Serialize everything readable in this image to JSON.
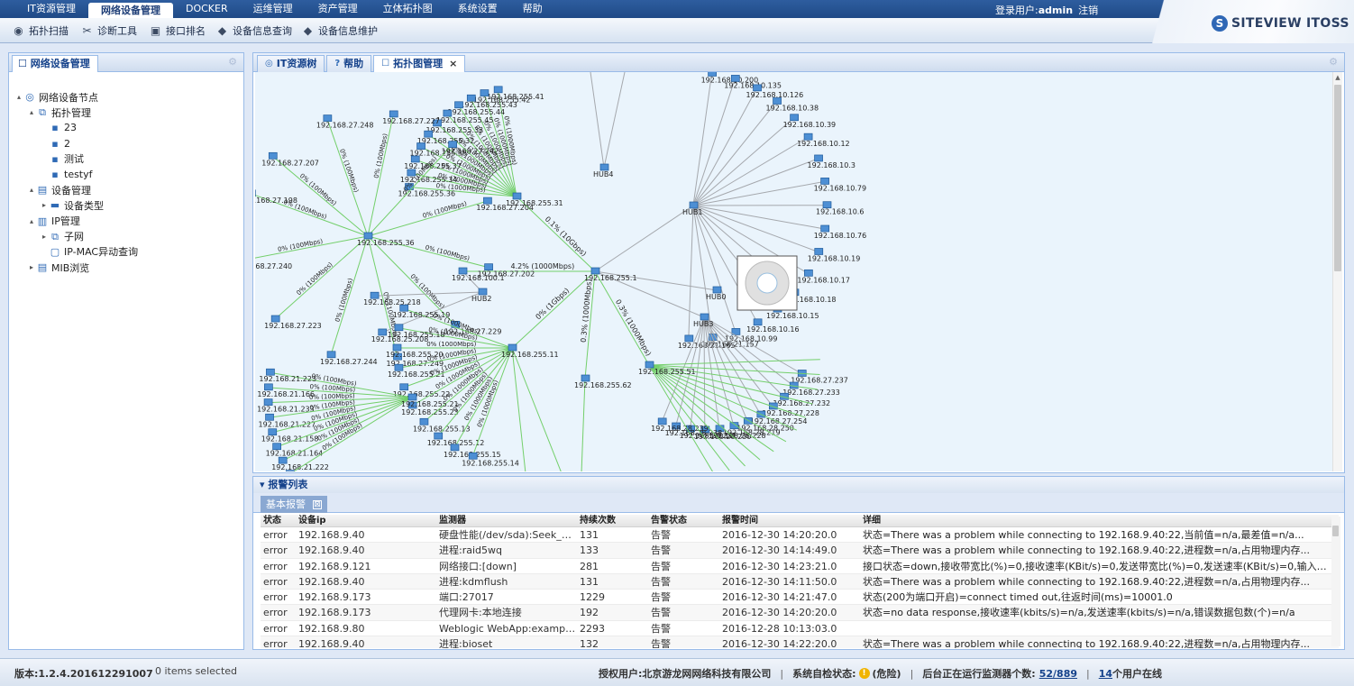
{
  "top_nav": {
    "items": [
      "IT资源管理",
      "网络设备管理",
      "DOCKER",
      "运维管理",
      "资产管理",
      "立体拓扑图",
      "系统设置",
      "帮助"
    ],
    "active_index": 1
  },
  "login": {
    "label": "登录用户:",
    "user": "admin",
    "logout": "注销"
  },
  "brand": {
    "mark": "S",
    "name": "SITEVIEW ITOSS",
    "accent": "#2f67b5"
  },
  "toolbar": [
    {
      "label": "拓扑扫描",
      "icon": "scan-icon"
    },
    {
      "label": "诊断工具",
      "icon": "tools-icon"
    },
    {
      "label": "接口排名",
      "icon": "monitor-icon"
    },
    {
      "label": "设备信息查询",
      "icon": "device-query-icon"
    },
    {
      "label": "设备信息维护",
      "icon": "device-maintain-icon"
    }
  ],
  "left_panel": {
    "title": "网络设备管理",
    "tree": [
      {
        "label": "网络设备节点",
        "level": 0,
        "arrow": "▴",
        "icon": "globe-icon"
      },
      {
        "label": "拓扑管理",
        "level": 1,
        "arrow": "▴",
        "icon": "topology-icon"
      },
      {
        "label": "23",
        "level": 2,
        "arrow": "",
        "icon": "topo-item-icon"
      },
      {
        "label": "2",
        "level": 2,
        "arrow": "",
        "icon": "topo-item-icon"
      },
      {
        "label": "测试",
        "level": 2,
        "arrow": "",
        "icon": "topo-item-icon"
      },
      {
        "label": "testyf",
        "level": 2,
        "arrow": "",
        "icon": "topo-item-icon"
      },
      {
        "label": "设备管理",
        "level": 1,
        "arrow": "▴",
        "icon": "device-icon"
      },
      {
        "label": "设备类型",
        "level": 2,
        "arrow": "▸",
        "icon": "device-type-icon"
      },
      {
        "label": "IP管理",
        "level": 1,
        "arrow": "▴",
        "icon": "ip-icon"
      },
      {
        "label": "子网",
        "level": 2,
        "arrow": "▸",
        "icon": "subnet-icon"
      },
      {
        "label": "IP-MAC异动查询",
        "level": 2,
        "arrow": "",
        "icon": "ipmac-icon"
      },
      {
        "label": "MIB浏览",
        "level": 1,
        "arrow": "▸",
        "icon": "mib-icon"
      }
    ]
  },
  "main_tabs": [
    {
      "label": "IT资源树",
      "icon": "resource-tree-icon",
      "active": false,
      "closable": false
    },
    {
      "label": "帮助",
      "icon": "help-icon",
      "active": false,
      "closable": false
    },
    {
      "label": "拓扑图管理",
      "icon": "topology-tab-icon",
      "active": true,
      "closable": true,
      "close": "×"
    }
  ],
  "topology": {
    "core": {
      "label": "192.168.255.1"
    },
    "core_links": [
      {
        "to": "192.168.255.31",
        "label": "0.1% (10Gbps)"
      },
      {
        "to": "192.168.100.1",
        "label": "4.2% (1000Mbps)"
      },
      {
        "to": "192.168.255.11",
        "label": "0% (1Gbps)"
      },
      {
        "to": "192.168.255.62",
        "label": "0.3% (1000Mbps)"
      },
      {
        "to": "192.168.255.51",
        "label": "0.3% (1000Mbps)"
      },
      {
        "to": "HUB0",
        "label": ""
      },
      {
        "to": "HUB1",
        "label": ""
      },
      {
        "to": "HUB3",
        "label": ""
      }
    ],
    "hubs": [
      "HUB4",
      "HUB1",
      "HUB0",
      "HUB2",
      "HUB3"
    ],
    "hub1_leaves": [
      "192.168.10.200",
      "192.168.10.135",
      "192.168.10.126",
      "192.168.10.38",
      "192.168.10.39",
      "192.168.10.12",
      "192.168.10.3",
      "192.168.10.79",
      "192.168.10.6",
      "192.168.10.76",
      "192.168.10.19",
      "192.168.10.17",
      "192.168.10.18",
      "192.168.10.15",
      "192.168.10.16",
      "192.168.10.99",
      "192.168.21.157",
      "192.168.21.165"
    ],
    "hub3_leaves": [
      "192.168.27.237",
      "192.168.27.233",
      "192.168.27.232",
      "192.168.27.228",
      "192.168.27.254",
      "192.168.28.250",
      "192.168.28.219",
      "192.168.28.228",
      "192.168.28.230",
      "192.168.28.231",
      "192.168.28.238",
      "192.168.28.239"
    ],
    "s31_leaves": [
      "192.168.255.41",
      "192.168.255.42",
      "192.168.255.43",
      "192.168.255.44",
      "192.168.255.45",
      "192.168.255.33",
      "192.168.255.32",
      "192.168.255.35",
      "192.168.255.37",
      "192.168.255.34",
      "192.168.255.36"
    ],
    "s31_link_label": "0% (1000Mbps)",
    "s36_leaves": [
      "192.168.27.207",
      "192.168.27.248",
      "192.168.27.227",
      "192.168.27.242",
      "192.168.27.204",
      "192.168.27.202",
      "192.168.27.229",
      "192.168.27.249",
      "192.168.27.244",
      "192.168.27.223",
      "192.168.27.240",
      "192.168.27.198"
    ],
    "s36_link_label": "0% (100Mbps)",
    "hub2_leaves": [
      "192.168.25.218",
      "192.168.25.208"
    ],
    "s11_leaves": [
      "192.168.255.19",
      "192.168.255.18",
      "192.168.255.20",
      "192.168.255.21",
      "192.168.255.22",
      "192.168.255.23",
      "192.168.255.13",
      "192.168.255.12",
      "192.168.255.15",
      "192.168.255.14"
    ],
    "s21_leaves": [
      "192.168.21.223",
      "192.168.21.166",
      "192.168.21.233",
      "192.168.21.227",
      "192.168.21.158",
      "192.168.21.164",
      "192.168.21.222",
      "192.168.21.167"
    ],
    "s21_link_label": "0% (100Mbps)",
    "pie_colors": [
      "#4a7fb9",
      "#8fbf6a",
      "#e0e0e0"
    ]
  },
  "alarm": {
    "title": "报警列表",
    "subtab": "基本报警",
    "close": "⊠",
    "columns": [
      "状态",
      "设备ip",
      "监测器",
      "持续次数",
      "告警状态",
      "报警时间",
      "详细"
    ],
    "rows": [
      [
        "error",
        "192.168.9.40",
        "硬盘性能(/dev/sda):Seek_Error...",
        "131",
        "告警",
        "2016-12-30 14:20:20.0",
        "状态=There was a problem while connecting to 192.168.9.40:22,当前值=n/a,最差值=n/a..."
      ],
      [
        "error",
        "192.168.9.40",
        "进程:raid5wq",
        "133",
        "告警",
        "2016-12-30 14:14:49.0",
        "状态=There was a problem while connecting to 192.168.9.40:22,进程数=n/a,占用物理内存..."
      ],
      [
        "error",
        "192.168.9.121",
        "网络接口:[down]",
        "281",
        "告警",
        "2016-12-30 14:23:21.0",
        "接口状态=down,接收带宽比(%)=0,接收速率(KBit/s)=0,发送带宽比(%)=0,发送速率(KBit/s)=0,输入丢..."
      ],
      [
        "error",
        "192.168.9.40",
        "进程:kdmflush",
        "131",
        "告警",
        "2016-12-30 14:11:50.0",
        "状态=There was a problem while connecting to 192.168.9.40:22,进程数=n/a,占用物理内存..."
      ],
      [
        "error",
        "192.168.9.173",
        "端口:27017",
        "1229",
        "告警",
        "2016-12-30 14:21:47.0",
        "状态(200为端口开启)=connect timed out,往返时间(ms)=10001.0"
      ],
      [
        "error",
        "192.168.9.173",
        "代理网卡:本地连接",
        "192",
        "告警",
        "2016-12-30 14:20:20.0",
        "状态=no data response,接收速率(kbits/s)=n/a,发送速率(kbits/s)=n/a,错误数据包数(个)=n/a"
      ],
      [
        "error",
        "192.168.9.80",
        "Weblogic WebApp:examplesSe...",
        "2293",
        "告警",
        "2016-12-28 10:13:03.0",
        ""
      ],
      [
        "error",
        "192.168.9.40",
        "进程:bioset",
        "132",
        "告警",
        "2016-12-30 14:22:20.0",
        "状态=There was a problem while connecting to 192.168.9.40:22,进程数=n/a,占用物理内存..."
      ]
    ]
  },
  "status_bar": {
    "version": "版本:1.2.4.201612291007",
    "selected": "0 items selected",
    "licensed_label": "授权用户:",
    "licensed_value": "北京游龙网网络科技有限公司",
    "sep": "|",
    "selfcheck_label": "系统自检状态:",
    "selfcheck_icon": "!",
    "selfcheck_value": "(危险)",
    "monitors_label": "后台正在运行监测器个数:",
    "monitors_value": "52/889",
    "online_count": "14",
    "online_label": "个用户在线"
  }
}
